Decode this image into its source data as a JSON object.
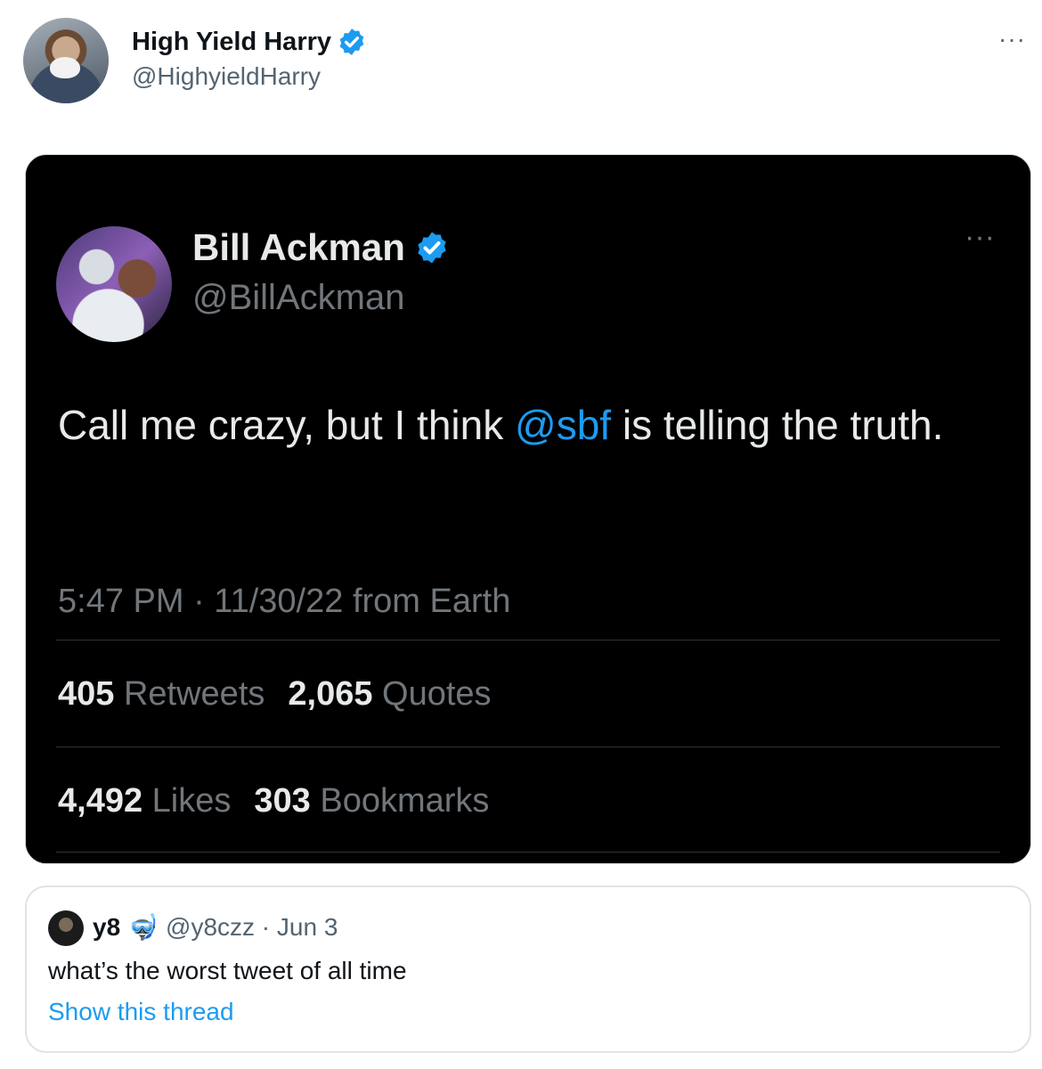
{
  "tweet": {
    "author_name": "High Yield Harry",
    "author_handle": "@HighyieldHarry",
    "more": "···"
  },
  "quoted": {
    "author_name": "Bill Ackman",
    "author_handle": "@BillAckman",
    "more": "···",
    "text_before": "Call me crazy, but I think ",
    "mention": "@sbf",
    "text_after": " is telling the truth.",
    "timestamp": "5:47 PM · 11/30/22 from Earth",
    "stats": {
      "retweets_count": "405",
      "retweets_label": "Retweets",
      "quotes_count": "2,065",
      "quotes_label": "Quotes",
      "likes_count": "4,492",
      "likes_label": "Likes",
      "bookmarks_count": "303",
      "bookmarks_label": "Bookmarks"
    }
  },
  "reply": {
    "name": "y8",
    "emoji": "🤿",
    "handle_date": "@y8czz · Jun 3",
    "text": "what’s the worst tweet of all time",
    "link": "Show this thread"
  },
  "colors": {
    "accent": "#1d9bf0",
    "dark_bg": "#000000",
    "muted": "#536471"
  }
}
